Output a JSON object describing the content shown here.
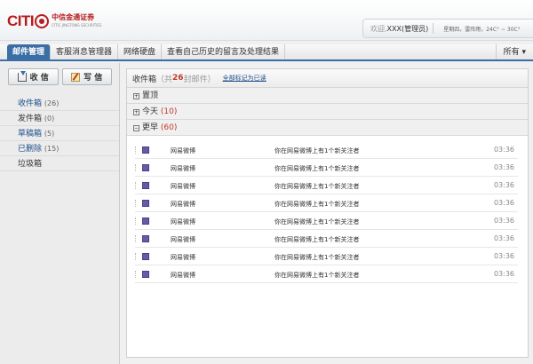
{
  "brand": {
    "logo_main": "CITI",
    "logo_cn": "中信金通证券",
    "logo_en": "CITIC JINGTONG SECURITIES"
  },
  "topbar": {
    "welcome_label": "欢迎,",
    "user": "XXX(管理员)",
    "weather": "星期四，雷阵雨，24C° ~ 30C°"
  },
  "nav": {
    "tabs": [
      {
        "label": "邮件管理"
      },
      {
        "label": "客服消息管理器"
      },
      {
        "label": "网络硬盘"
      },
      {
        "label": "查看自己历史的留言及处理结果"
      }
    ],
    "more": "所有 ▾"
  },
  "sidebar": {
    "receive_label": "收 信",
    "write_label": "写 信",
    "folders": [
      {
        "label": "收件箱",
        "count": "(26)"
      },
      {
        "label": "发件箱",
        "count": "(0)"
      },
      {
        "label": "草稿箱",
        "count": "(5)"
      },
      {
        "label": "已删除",
        "count": "(15)"
      },
      {
        "label": "垃圾箱",
        "count": ""
      }
    ]
  },
  "inbox": {
    "title": "收件箱",
    "count_prefix": "（共",
    "count": "26",
    "count_suffix": "封邮件）",
    "mark_all": "全部标记为已读",
    "groups": [
      {
        "icon": "+",
        "label": "置顶",
        "count": ""
      },
      {
        "icon": "+",
        "label": "今天",
        "count": "(10)"
      },
      {
        "icon": "−",
        "label": "更早",
        "count": "(60)"
      }
    ],
    "rows": [
      {
        "from": "网易微博",
        "subject": "你在网易微博上有1个新关注者",
        "time": "03:36"
      },
      {
        "from": "网易微博",
        "subject": "你在网易微博上有1个新关注者",
        "time": "03:36"
      },
      {
        "from": "网易微博",
        "subject": "你在网易微博上有1个新关注者",
        "time": "03:36"
      },
      {
        "from": "网易微博",
        "subject": "你在网易微博上有1个新关注者",
        "time": "03:36"
      },
      {
        "from": "网易微博",
        "subject": "你在网易微博上有1个新关注者",
        "time": "03:36"
      },
      {
        "from": "网易微博",
        "subject": "你在网易微博上有1个新关注者",
        "time": "03:36"
      },
      {
        "from": "网易微博",
        "subject": "你在网易微博上有1个新关注者",
        "time": "03:36"
      },
      {
        "from": "网易微博",
        "subject": "你在网易微博上有1个新关注者",
        "time": "03:36"
      }
    ]
  }
}
